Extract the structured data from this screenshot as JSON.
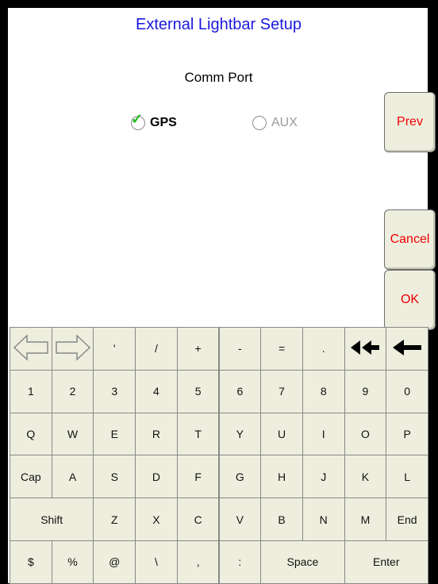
{
  "title": "External Lightbar Setup",
  "comm_port": {
    "label": "Comm Port",
    "options": [
      {
        "label": "GPS",
        "selected": true,
        "enabled": true
      },
      {
        "label": "AUX",
        "selected": false,
        "enabled": false
      }
    ]
  },
  "buttons": {
    "prev": "Prev",
    "cancel": "Cancel",
    "ok": "OK"
  },
  "keyboard": {
    "row0": [
      {
        "label": "",
        "icon": "left-arrow-outline-icon"
      },
      {
        "label": "",
        "icon": "right-arrow-outline-icon"
      },
      {
        "label": "'"
      },
      {
        "label": "/"
      },
      {
        "label": "+"
      },
      {
        "label": "-"
      },
      {
        "label": "="
      },
      {
        "label": "."
      },
      {
        "label": "",
        "icon": "double-left-arrow-icon"
      },
      {
        "label": "",
        "icon": "backspace-arrow-icon"
      }
    ],
    "row1": [
      "1",
      "2",
      "3",
      "4",
      "5",
      "6",
      "7",
      "8",
      "9",
      "0"
    ],
    "row2": [
      "Q",
      "W",
      "E",
      "R",
      "T",
      "Y",
      "U",
      "I",
      "O",
      "P"
    ],
    "row3": [
      "Cap",
      "A",
      "S",
      "D",
      "F",
      "G",
      "H",
      "J",
      "K",
      "L"
    ],
    "row4": [
      "Shift",
      "Z",
      "X",
      "C",
      "V",
      "B",
      "N",
      "M",
      "End"
    ],
    "row5": [
      "$",
      "%",
      "@",
      "\\",
      ",",
      ":",
      "Space",
      "Enter"
    ]
  },
  "colors": {
    "title": "#1a1adc",
    "button_text": "#ee0000",
    "checkmark": "#1cb81c",
    "disabled": "#9a9a9a",
    "key_bg": "#eeeede"
  }
}
